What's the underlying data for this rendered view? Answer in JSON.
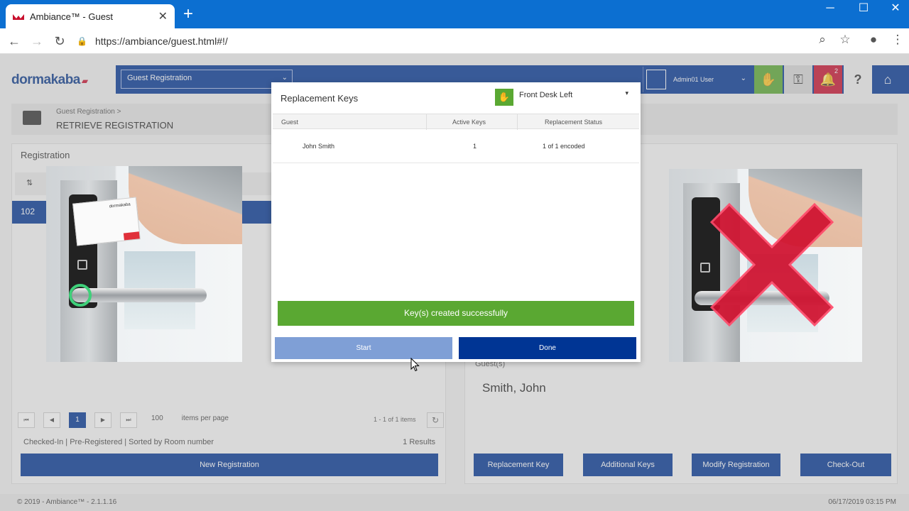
{
  "browser": {
    "tab_title": "Ambiance™ - Guest",
    "url": "https://ambiance/guest.html#!/"
  },
  "header": {
    "logo": "dormakaba",
    "module_select": "Guest Registration",
    "user_name": "Admin01 User",
    "notification_count": "2",
    "help_label": "?"
  },
  "breadcrumb": {
    "parent": "Guest Registration >",
    "title": "RETRIEVE REGISTRATION"
  },
  "left_panel": {
    "title": "Registration",
    "selected_room": "102",
    "pager": {
      "first": "⏮",
      "prev": "◀",
      "page": "1",
      "next": "▶",
      "last": "⏭"
    },
    "per_page_value": "100",
    "per_page_label": "items per page",
    "items_count": "1 - 1 of 1 items",
    "filter_text": "Checked-In | Pre-Registered | Sorted by Room number",
    "results": "1 Results",
    "new_registration": "New Registration"
  },
  "right_panel": {
    "guests_label": "Guest(s)",
    "guest_name": "Smith, John",
    "actions": {
      "replacement_key": "Replacement Key",
      "additional_keys": "Additional Keys",
      "modify_registration": "Modify Registration",
      "check_out": "Check-Out"
    }
  },
  "modal": {
    "title": "Replacement Keys",
    "encoder": "Front Desk Left",
    "columns": {
      "guest": "Guest",
      "active_keys": "Active Keys",
      "status": "Replacement Status"
    },
    "rows": [
      {
        "guest": "John Smith",
        "active_keys": "1",
        "status": "1 of 1 encoded"
      }
    ],
    "success_message": "Key(s) created successfully",
    "start": "Start",
    "done": "Done"
  },
  "illustration": {
    "card_brand": "dormakaba"
  },
  "footer": {
    "copyright": "© 2019 - Ambiance™ - 2.1.1.16",
    "datetime": "06/17/2019 03:15 PM"
  },
  "colors": {
    "brand_blue": "#003594",
    "success_green": "#5aa832",
    "alert_red": "#c8102e",
    "chrome_blue": "#0c6fd1"
  }
}
